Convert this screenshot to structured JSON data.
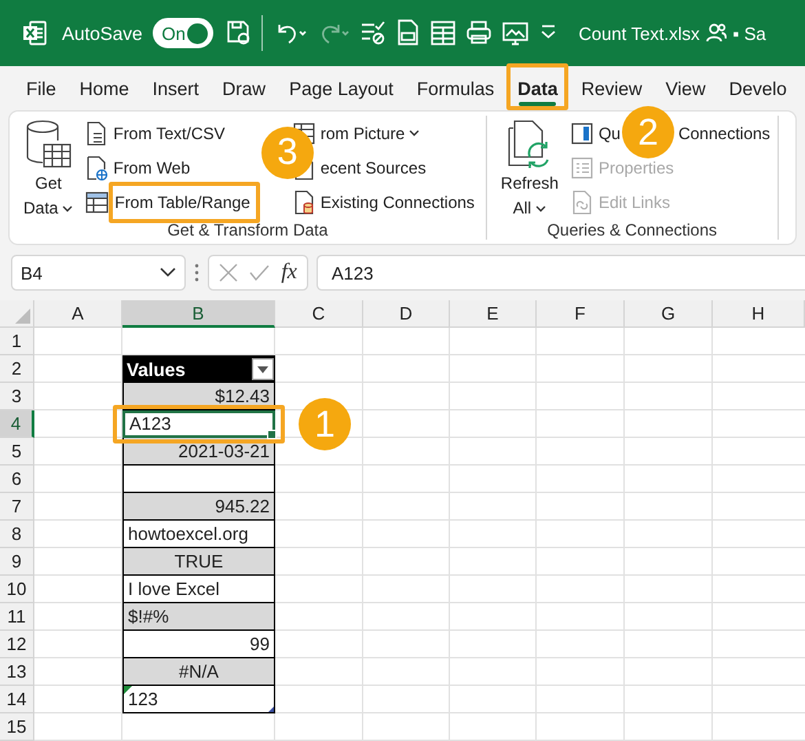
{
  "title_bar": {
    "autosave": {
      "label": "AutoSave",
      "on": true,
      "state_label": "On"
    },
    "quick_access": [
      {
        "kind": "save",
        "disabled": false
      },
      {
        "kind": "undo",
        "disabled": false
      },
      {
        "kind": "redo",
        "disabled": true
      },
      {
        "kind": "checklist",
        "disabled": false
      },
      {
        "kind": "pdf",
        "disabled": false
      },
      {
        "kind": "form",
        "disabled": false
      },
      {
        "kind": "print",
        "disabled": false
      },
      {
        "kind": "screen",
        "disabled": false
      },
      {
        "kind": "more",
        "disabled": false
      }
    ],
    "file_name": "Count Text.xlsx",
    "account": "▪ Sa"
  },
  "tabs": [
    {
      "label": "File",
      "selected": false
    },
    {
      "label": "Home",
      "selected": false
    },
    {
      "label": "Insert",
      "selected": false
    },
    {
      "label": "Draw",
      "selected": false
    },
    {
      "label": "Page Layout",
      "selected": false
    },
    {
      "label": "Formulas",
      "selected": false
    },
    {
      "label": "Data",
      "selected": true,
      "highlighted": true,
      "callout": "2"
    },
    {
      "label": "Review",
      "selected": false
    },
    {
      "label": "View",
      "selected": false
    },
    {
      "label": "Develo",
      "selected": false
    }
  ],
  "ribbon": {
    "groups": [
      {
        "label": "Get & Transform Data",
        "columns": [
          [
            {
              "kind": "large",
              "lines": [
                "Get",
                "Data"
              ],
              "menu": true
            }
          ],
          [
            {
              "kind": "small",
              "label": "From Text/CSV",
              "disabled": false
            },
            {
              "kind": "small",
              "label": "From Web",
              "disabled": false
            },
            {
              "kind": "small",
              "label": "From Table/Range",
              "disabled": false,
              "highlighted": true,
              "callout": "3"
            }
          ],
          [
            {
              "kind": "small",
              "label": "rom Picture",
              "menu": true,
              "disabled": false
            },
            {
              "kind": "small",
              "label": "ecent Sources",
              "disabled": false
            },
            {
              "kind": "small",
              "label": "Existing Connections",
              "disabled": false
            }
          ]
        ]
      },
      {
        "label": "Queries & Connections",
        "columns": [
          [
            {
              "kind": "large",
              "lines": [
                "Refresh",
                "All"
              ],
              "menu": true
            }
          ],
          [
            {
              "kind": "split",
              "parts": [
                "Qu",
                "Connections"
              ]
            },
            {
              "kind": "small",
              "label": "Properties",
              "disabled": true
            },
            {
              "kind": "small",
              "label": "Edit Links",
              "disabled": true
            }
          ]
        ]
      }
    ]
  },
  "formula_bar": {
    "name_box": "B4",
    "function_label": "fx",
    "formula": "A123"
  },
  "sheet": {
    "columns": [
      {
        "label": "A",
        "selected": false
      },
      {
        "label": "B",
        "selected": true
      },
      {
        "label": "C",
        "selected": false
      },
      {
        "label": "D",
        "selected": false
      },
      {
        "label": "E",
        "selected": false
      },
      {
        "label": "F",
        "selected": false
      },
      {
        "label": "G",
        "selected": false
      },
      {
        "label": "H",
        "selected": false
      }
    ],
    "rows": [
      {
        "number": "1",
        "selected": false
      },
      {
        "number": "2",
        "selected": false,
        "cell": {
          "kind": "header",
          "text": "Values"
        }
      },
      {
        "number": "3",
        "selected": false,
        "cell": {
          "kind": "number",
          "text": "$12.43",
          "shaded": true
        }
      },
      {
        "number": "4",
        "selected": true,
        "cell": {
          "kind": "text",
          "text": "A123",
          "shaded": false,
          "highlighted": true,
          "callout": "1"
        }
      },
      {
        "number": "5",
        "selected": false,
        "cell": {
          "kind": "number",
          "text": "2021-03-21",
          "shaded": true
        }
      },
      {
        "number": "6",
        "selected": false,
        "cell": {
          "kind": "empty",
          "shaded": false
        }
      },
      {
        "number": "7",
        "selected": false,
        "cell": {
          "kind": "number",
          "text": "945.22",
          "shaded": true
        }
      },
      {
        "number": "8",
        "selected": false,
        "cell": {
          "kind": "text",
          "text": "howtoexcel.org",
          "shaded": false
        }
      },
      {
        "number": "9",
        "selected": false,
        "cell": {
          "kind": "logical",
          "text": "TRUE",
          "shaded": true
        }
      },
      {
        "number": "10",
        "selected": false,
        "cell": {
          "kind": "text",
          "text": "I love Excel",
          "shaded": false
        }
      },
      {
        "number": "11",
        "selected": false,
        "cell": {
          "kind": "text",
          "text": "$!#%",
          "shaded": true
        }
      },
      {
        "number": "12",
        "selected": false,
        "cell": {
          "kind": "number",
          "text": "99",
          "shaded": false
        }
      },
      {
        "number": "13",
        "selected": false,
        "cell": {
          "kind": "error",
          "text": "#N/A",
          "shaded": true
        }
      },
      {
        "number": "14",
        "selected": false,
        "cell": {
          "kind": "text",
          "text": "123",
          "shaded": false,
          "error_flag": true
        }
      },
      {
        "number": "15",
        "selected": false
      }
    ]
  }
}
